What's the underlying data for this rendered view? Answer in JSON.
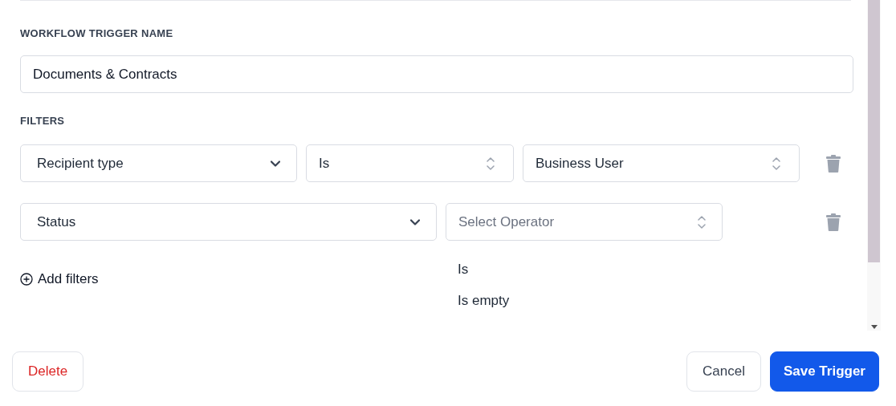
{
  "trigger_name": {
    "label": "WORKFLOW TRIGGER NAME",
    "value": "Documents & Contracts"
  },
  "filters": {
    "label": "FILTERS",
    "rows": [
      {
        "fields": [
          {
            "kind": "dropdown",
            "value": "Recipient type"
          },
          {
            "kind": "picker",
            "value": "Is"
          },
          {
            "kind": "picker",
            "value": "Business User"
          }
        ]
      },
      {
        "fields": [
          {
            "kind": "dropdown",
            "value": "Status"
          },
          {
            "kind": "picker",
            "placeholder": "Select Operator",
            "expanded": true,
            "options": [
              "Is",
              "Is empty"
            ]
          }
        ]
      }
    ]
  },
  "add_filters": "Add filters",
  "buttons": [
    {
      "kind": "danger",
      "label": "Delete"
    },
    {
      "kind": "secondary",
      "label": "Cancel"
    },
    {
      "kind": "primary",
      "label": "Save Trigger"
    }
  ]
}
